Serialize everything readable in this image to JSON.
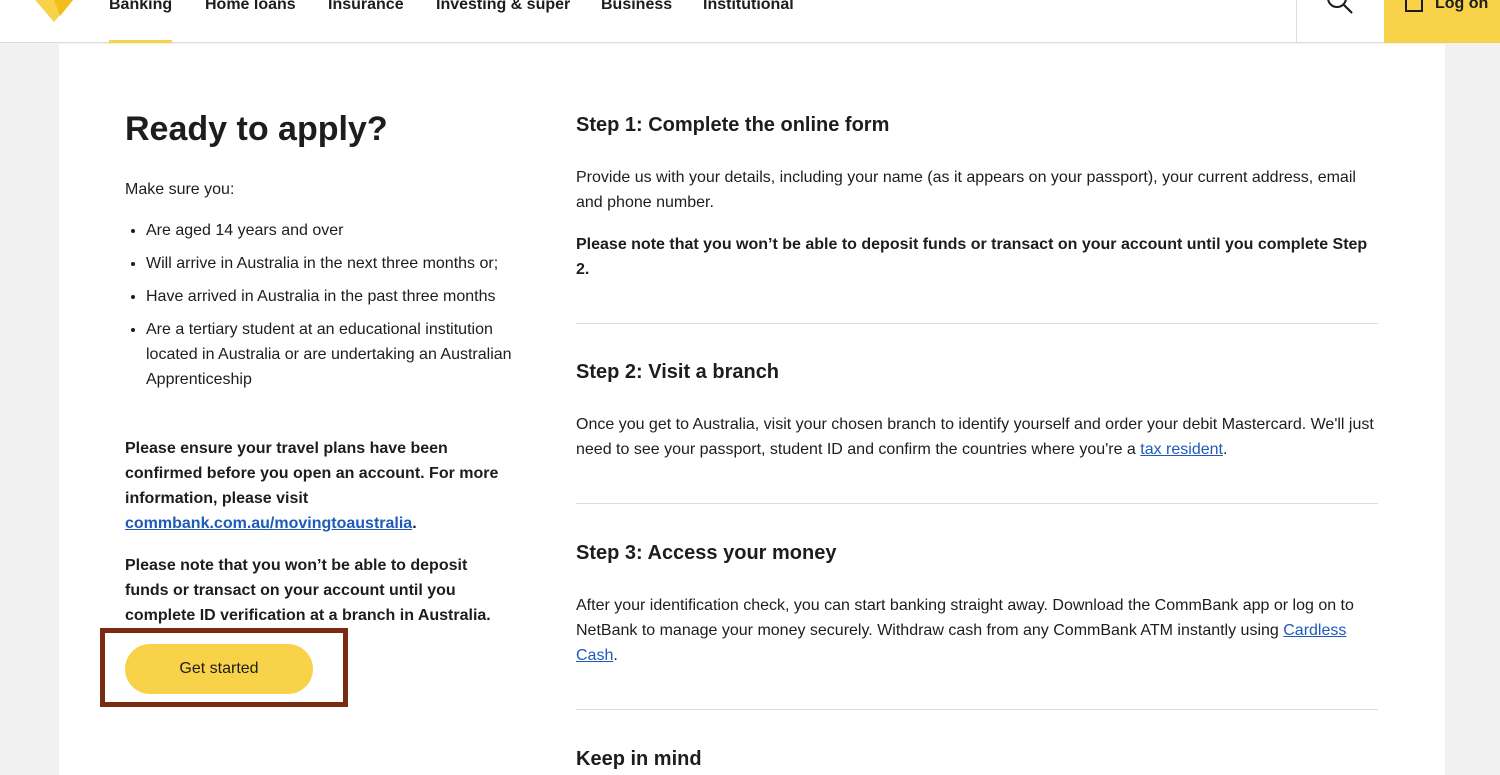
{
  "nav": {
    "items": [
      "Banking",
      "Home loans",
      "Insurance",
      "Investing & super",
      "Business",
      "Institutional"
    ],
    "active_index": 0,
    "logon_label": "Log on",
    "search_icon": "search-icon",
    "lock_icon": "lock-icon",
    "accent_color": "#f8d34a"
  },
  "left": {
    "heading": "Ready to apply?",
    "intro": "Make sure you:",
    "requirements": [
      "Are aged 14 years and over",
      "Will arrive in Australia in the next three months or;",
      "Have arrived in Australia in the past three months",
      "Are a tertiary student at an educational institution located in Australia or are undertaking an Australian Apprenticeship"
    ],
    "travel_note_before": "Please ensure your travel plans have been confirmed before you open an account. For more information, please visit ",
    "travel_link": "commbank.com.au/movingtoaustralia",
    "travel_note_after": ".",
    "deposit_note": "Please note that you won’t be able to deposit funds or transact on your account until you complete ID verification at a branch in Australia.",
    "cta_label": "Get started"
  },
  "steps": {
    "step1_title": "Step 1: Complete the online form",
    "step1_text": "Provide us with your details, including your name (as it appears on your passport), your current address, email and phone number.",
    "step1_note": "Please note that you won’t be able to deposit funds or transact on your account until you complete Step 2.",
    "step2_title": "Step 2: Visit a branch",
    "step2_text_before": "Once you get to Australia, visit your chosen branch to identify yourself and order your debit Mastercard. We'll just need to see your passport, student ID and confirm the countries where you're a ",
    "step2_link": "tax resident",
    "step2_text_after": ".",
    "step3_title": "Step 3: Access your money",
    "step3_text_before": "After your identification check, you can start banking straight away. Download the CommBank app or log on to NetBank to manage your money securely. Withdraw cash from any CommBank ATM instantly using ",
    "step3_link": "Cardless Cash",
    "step3_text_after": ".",
    "keep_title": "Keep in mind"
  }
}
